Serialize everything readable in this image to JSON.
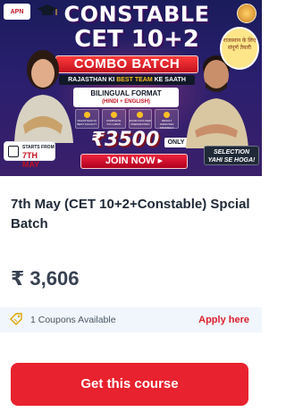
{
  "banner": {
    "logo_text": "APN",
    "headline_line1": "CONSTABLE",
    "headline_line2": "CET 10+2",
    "combo_label": "COMBO BATCH",
    "tagline_prefix": "RAJASTHAN KI",
    "tagline_highlight": "BEST TEAM",
    "tagline_suffix": "KE SAATH",
    "bilingual_title": "BILINGUAL FORMAT",
    "bilingual_sub": "(HINDI + ENGLISH)",
    "features": [
      "RAJASTHAN KI BEST FACULTY",
      "COMPLETE SYLLABUS",
      "EXAM FOCUSED PREPARATION",
      "RESULT ORIENTED STRATEGY"
    ],
    "price": "₹3500",
    "price_suffix": "ONLY",
    "join_label": "JOIN NOW ▸",
    "starts_label": "STARTS FROM",
    "starts_date": "7TH MAY",
    "selection_line1": "SELECTION",
    "selection_line2": "YAHI SE HOGA!",
    "badge_text": "राजस्थान के लिए संपूर्ण तैयारी"
  },
  "course": {
    "title": "7th May (CET 10+2+Constable) Spcial Batch",
    "price": "₹ 3,606"
  },
  "coupon": {
    "icon": "tag-icon",
    "text": "1 Coupons Available",
    "apply_label": "Apply here"
  },
  "cta": {
    "label": "Get this course"
  },
  "colors": {
    "accent": "#e8222e",
    "apply": "#dc1e2d",
    "coupon_bg": "#f0f6fb"
  }
}
